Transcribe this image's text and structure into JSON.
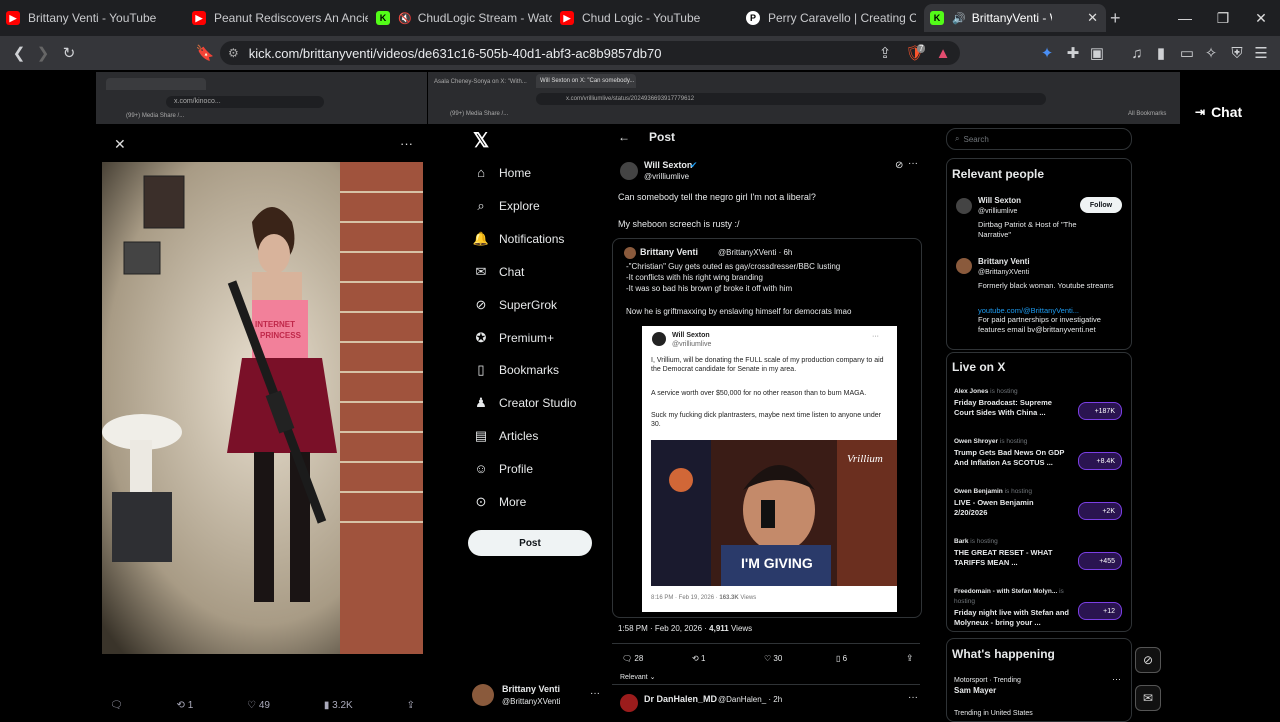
{
  "browser": {
    "tabs": [
      {
        "title": "Brittany Venti - YouTube",
        "icon": "youtube-icon"
      },
      {
        "title": "Peanut Rediscovers An Ancient L",
        "icon": "youtube-icon"
      },
      {
        "title": "ChudLogic Stream - Watch L",
        "icon": "kick-icon"
      },
      {
        "title": "Chud Logic - YouTube",
        "icon": "youtube-icon"
      },
      {
        "title": "Perry Caravello | Creating Come",
        "icon": "patreon-icon"
      },
      {
        "title": "BrittanyVenti - Watch the",
        "icon": "kick-icon"
      }
    ],
    "url": "kick.com/brittanyventi/videos/de631c16-505b-40d1-abf3-ac8b9857db70",
    "brave_badge": "7"
  },
  "left_window": {
    "url": "x.com/kinoco...",
    "bookmark_label": "(99+) Media Share /...",
    "shirt_text": "INTERNET PRINCESS",
    "actions": {
      "reply": "",
      "repost": "1",
      "likes": "49",
      "views": "3.2K"
    }
  },
  "right_window": {
    "tabs": [
      "Asala Cheney-Sonya on X: \"With...",
      "Will Sexton on X: \"Can somebody..."
    ],
    "url": "x.com/vrilliumlive/status/2024936693917779612",
    "bookmark_label": "(99+) Media Share /...",
    "all_bookmarks": "All Bookmarks"
  },
  "x": {
    "nav": [
      "Home",
      "Explore",
      "Notifications",
      "Chat",
      "SuperGrok",
      "Premium+",
      "Bookmarks",
      "Creator Studio",
      "Articles",
      "Profile",
      "More"
    ],
    "post_button": "Post",
    "header": "Post",
    "account": {
      "name": "Brittany Venti",
      "handle": "@BrittanyXVenti"
    },
    "post": {
      "author": "Will Sexton",
      "handle": "@vrilliumlive",
      "line1": "Can somebody tell the negro girl I'm not a liberal?",
      "line2": "My sheboon screech is rusty :/",
      "timestamp": "1:58 PM · Feb 20, 2026 ·",
      "views": "4,911",
      "views_label": "Views",
      "stats": {
        "replies": "28",
        "reposts": "1",
        "likes": "30",
        "bookmarks": "6"
      },
      "relevant_label": "Relevant"
    },
    "quoted": {
      "author": "Brittany Venti",
      "handle": "@BrittanyXVenti · 6h",
      "lines": [
        "-\"Christian\" Guy gets outed as gay/crossdresser/BBC lusting",
        "-It conflicts with his right wing branding",
        "-It was so bad his brown gf broke it off with him"
      ],
      "tail": "Now he is griftmaxxing by enslaving himself for democrats lmao"
    },
    "card": {
      "author": "Will Sexton",
      "handle": "@vrilliumlive",
      "p1": "I, Vrillium, will be donating the FULL scale of my production company to aid the Democrat candidate for Senate in my area.",
      "p2": "A service worth over $50,000 for no other reason than to burn MAGA.",
      "p3": "Suck my fucking dick plantrasters, maybe next time listen to anyone under 30.",
      "footer": "8:16 PM · Feb 19, 2026 ·",
      "footer_views": "163.3K",
      "footer_views_label": "Views",
      "image_caption": "I'M GIVING",
      "image_watermark": "Vrillium"
    },
    "reply": {
      "author": "Dr DanHalen_MD",
      "handle": "@DanHalen_ · 2h"
    },
    "search_placeholder": "Search",
    "relevant_people": {
      "heading": "Relevant people",
      "people": [
        {
          "name": "Will Sexton",
          "handle": "@vrilliumlive",
          "bio": "Dirtbag Patriot & Host of \"The Narrative\"",
          "follow": "Follow"
        },
        {
          "name": "Brittany Venti",
          "handle": "@BrittanyXVenti",
          "bio": "Formerly black woman. Youtube streams",
          "link": "youtube.com/@BrittanyVenti...",
          "bio2": "For paid partnerships or investigative features email bv@brittanyventi.net"
        }
      ]
    },
    "live": {
      "heading": "Live on X",
      "items": [
        {
          "host": "Alex Jones",
          "status": "is hosting",
          "title": "Friday Broadcast: Supreme Court Sides With China ...",
          "count": "+187K"
        },
        {
          "host": "Owen Shroyer",
          "status": "is hosting",
          "title": "Trump Gets Bad News On GDP And Inflation As SCOTUS ...",
          "count": "+8.4K"
        },
        {
          "host": "Owen Benjamin",
          "status": "is hosting",
          "title": "LIVE - Owen Benjamin 2/20/2026",
          "count": "+2K"
        },
        {
          "host": "Bark",
          "status": "is hosting",
          "title": "THE GREAT RESET - WHAT TARIFFS MEAN ...",
          "count": "+455"
        },
        {
          "host": "Freedomain - with Stefan Molyn...",
          "status": "is hosting",
          "title": "Friday night live with Stefan and Molyneux - bring your ...",
          "count": "+12"
        }
      ]
    },
    "happening": {
      "heading": "What's happening",
      "category": "Motorsport · Trending",
      "topic": "Sam Mayer",
      "next": "Trending in United States"
    }
  },
  "kick": {
    "chat_label": "Chat"
  },
  "colors": {
    "accent": "#1d9bf0",
    "kick_green": "#53fc18",
    "youtube_red": "#ff0000"
  }
}
